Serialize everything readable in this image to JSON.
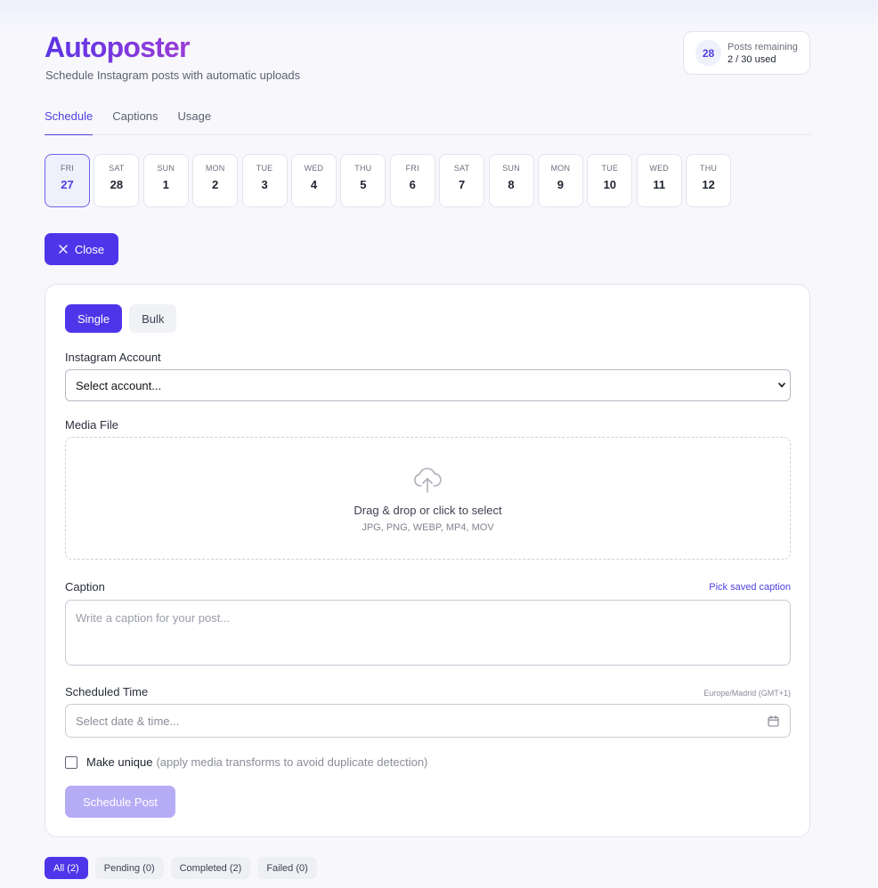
{
  "app": {
    "title": "Autoposter",
    "subtitle": "Schedule Instagram posts with automatic uploads"
  },
  "quota": {
    "count": "28",
    "label": "Posts remaining",
    "used": "2 / 30 used"
  },
  "tabs": [
    {
      "label": "Schedule",
      "active": true
    },
    {
      "label": "Captions",
      "active": false
    },
    {
      "label": "Usage",
      "active": false
    }
  ],
  "days": [
    {
      "name": "FRI",
      "num": "27",
      "active": true
    },
    {
      "name": "SAT",
      "num": "28"
    },
    {
      "name": "SUN",
      "num": "1"
    },
    {
      "name": "MON",
      "num": "2"
    },
    {
      "name": "TUE",
      "num": "3"
    },
    {
      "name": "WED",
      "num": "4"
    },
    {
      "name": "THU",
      "num": "5"
    },
    {
      "name": "FRI",
      "num": "6"
    },
    {
      "name": "SAT",
      "num": "7"
    },
    {
      "name": "SUN",
      "num": "8"
    },
    {
      "name": "MON",
      "num": "9"
    },
    {
      "name": "TUE",
      "num": "10"
    },
    {
      "name": "WED",
      "num": "11"
    },
    {
      "name": "THU",
      "num": "12"
    }
  ],
  "close_label": "Close",
  "form": {
    "mode_single": "Single",
    "mode_bulk": "Bulk",
    "account_label": "Instagram Account",
    "account_value": "Select account...",
    "media_label": "Media File",
    "drop_title": "Drag & drop or click to select",
    "drop_formats": "JPG, PNG, WEBP, MP4, MOV",
    "caption_label": "Caption",
    "caption_link": "Pick saved caption",
    "caption_placeholder": "Write a caption for your post...",
    "time_label": "Scheduled Time",
    "timezone": "Europe/Madrid (GMT+1)",
    "time_placeholder": "Select date & time...",
    "unique_label": "Make unique",
    "unique_hint": "(apply media transforms to avoid duplicate detection)",
    "submit_label": "Schedule Post"
  },
  "filters": [
    {
      "label": "All (2)",
      "active": true
    },
    {
      "label": "Pending (0)"
    },
    {
      "label": "Completed (2)"
    },
    {
      "label": "Failed (0)"
    }
  ],
  "colors": {
    "accent": "#4f35ea",
    "accent_soft": "#b6acf6"
  }
}
